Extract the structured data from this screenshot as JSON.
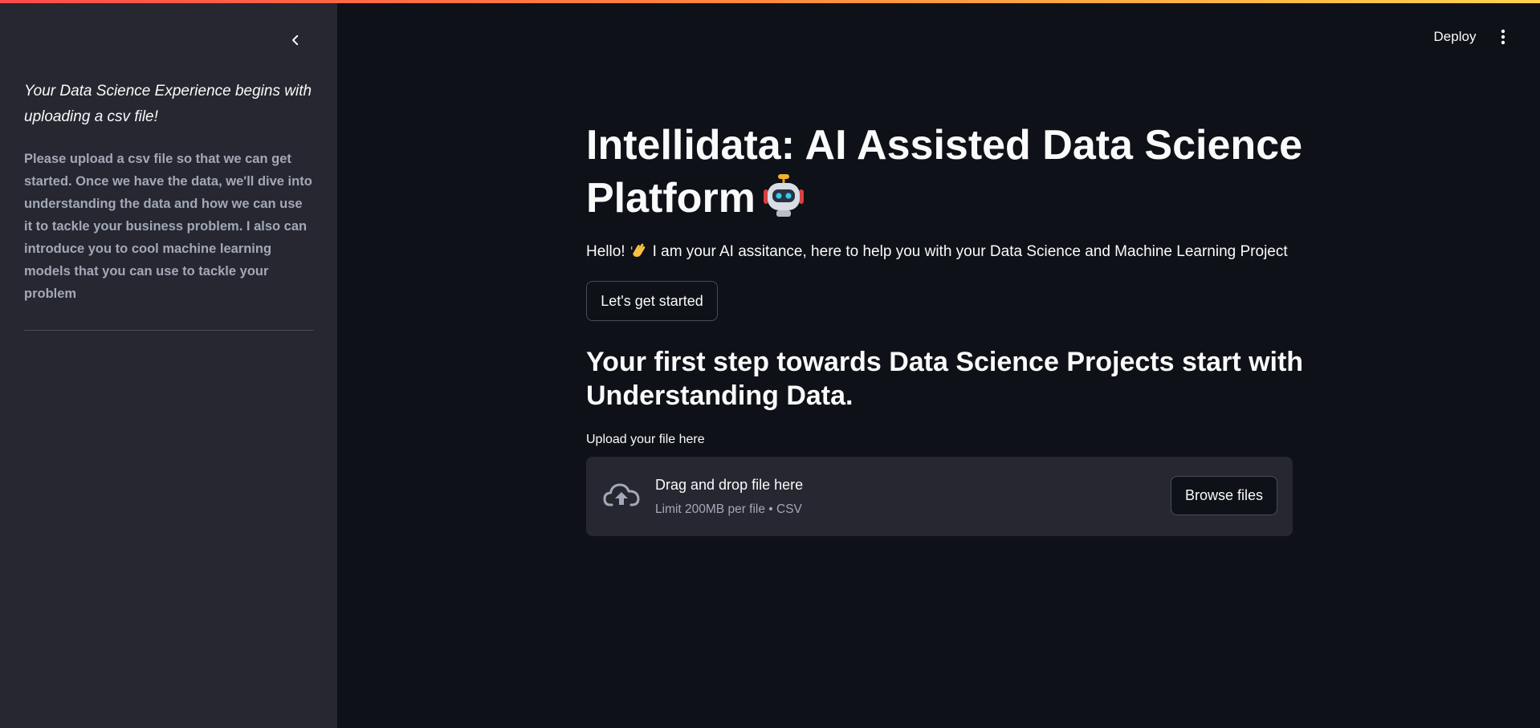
{
  "sidebar": {
    "collapse_icon": "chevron-left-icon",
    "heading": "Your Data Science Experience begins with uploading a csv file!",
    "body": "Please upload a csv file so that we can get started. Once we have the data, we'll dive into understanding the data and how we can use it to tackle your business problem. I also can introduce you to cool machine learning models that you can use to tackle your problem"
  },
  "toolbar": {
    "deploy_label": "Deploy",
    "menu_icon": "more-vertical-icon"
  },
  "main": {
    "title": "Intellidata: AI Assisted Data Science Platform",
    "title_icon": "robot-emoji-icon",
    "greeting_prefix": "Hello!",
    "greeting_icon": "waving-hand-emoji-icon",
    "greeting_suffix": "I am your AI assitance, here to help you with your Data Science and Machine Learning Project",
    "start_button_label": "Let's get started",
    "section_heading": "Your first step towards Data Science Projects start with Understanding Data.",
    "uploader": {
      "label": "Upload your file here",
      "drop_text": "Drag and drop file here",
      "limit_text": "Limit 200MB per file • CSV",
      "browse_label": "Browse files",
      "icon": "cloud-upload-icon"
    }
  },
  "colors": {
    "background": "#0e1117",
    "sidebar": "#262730",
    "text": "#fafafa",
    "muted_text": "#a3a8b8",
    "accent_gradient": [
      "#ff4b4b",
      "#ff8a3d",
      "#ffd34e"
    ]
  }
}
